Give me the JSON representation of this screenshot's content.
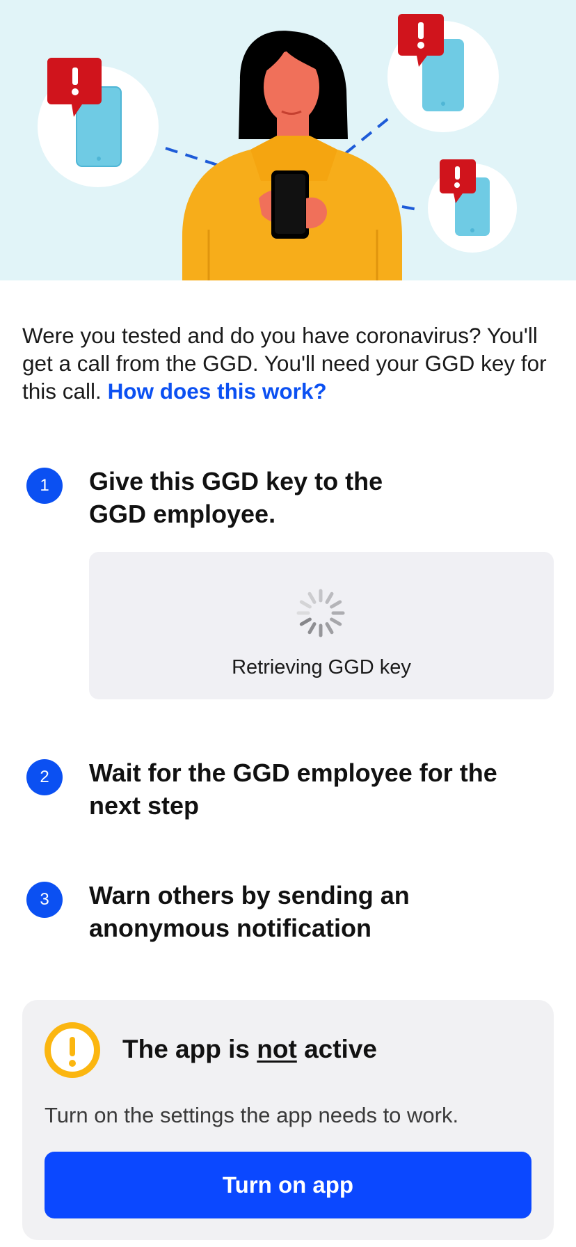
{
  "hero": {
    "illustration": "person-phone-notifications-illustration"
  },
  "intro": {
    "text": "Were you tested and do you have coronavirus? You'll get a call from the GGD. You'll need your GGD key for this call.",
    "link": "How does this work?"
  },
  "steps": [
    {
      "number": "1",
      "title_line1": "Give this GGD key to the",
      "title_line2": "GGD employee."
    },
    {
      "number": "2",
      "title_line1": "Wait for the GGD employee for the",
      "title_line2": "next step"
    },
    {
      "number": "3",
      "title_line1": "Warn others by sending an",
      "title_line2": "anonymous notification"
    }
  ],
  "key_box": {
    "status": "Retrieving GGD key",
    "icon": "loading-spinner-icon"
  },
  "warning": {
    "title_prefix": "The app is",
    "title_emph": "not",
    "title_suffix": "active",
    "body": "Turn on the settings the app needs to work.",
    "button": "Turn on app",
    "icon": "exclamation-circle-icon"
  },
  "colors": {
    "accent": "#0b50f2",
    "button": "#0b48ff",
    "warning": "#fbb610",
    "alert_red": "#d0141c",
    "hero_bg": "#e1f4f8"
  }
}
